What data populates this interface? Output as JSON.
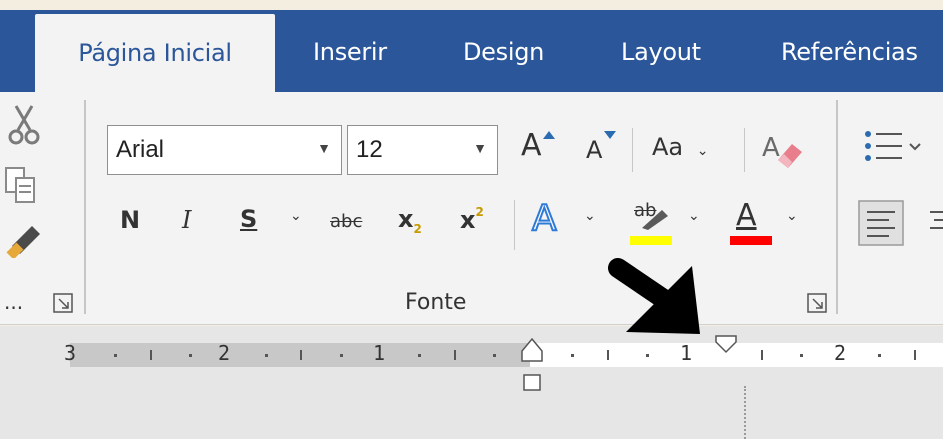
{
  "tabs": [
    {
      "label": "Página Inicial",
      "active": true
    },
    {
      "label": "Inserir"
    },
    {
      "label": "Design"
    },
    {
      "label": "Layout"
    },
    {
      "label": "Referências"
    }
  ],
  "font": {
    "family_value": "Arial",
    "size_value": "12",
    "grow_label": "A",
    "shrink_label": "A",
    "case_label": "Aa",
    "bold_label": "N",
    "italic_label": "I",
    "underline_label": "S",
    "strike_label": "abc",
    "subscript_label": "x",
    "subscript_mark": "2",
    "superscript_label": "x",
    "superscript_mark": "2",
    "effects_label": "A",
    "highlight_label": "ab",
    "font_color_label": "A",
    "group_label": "Fonte"
  },
  "clipboard": {
    "ellipsis": "..."
  },
  "ruler": {
    "left_numbers": [
      "3",
      "2",
      "1"
    ],
    "right_numbers": [
      "1",
      "2"
    ]
  },
  "colors": {
    "tab_bar": "#2b579a",
    "highlight": "#ffff00",
    "font_color": "#ff0000"
  }
}
